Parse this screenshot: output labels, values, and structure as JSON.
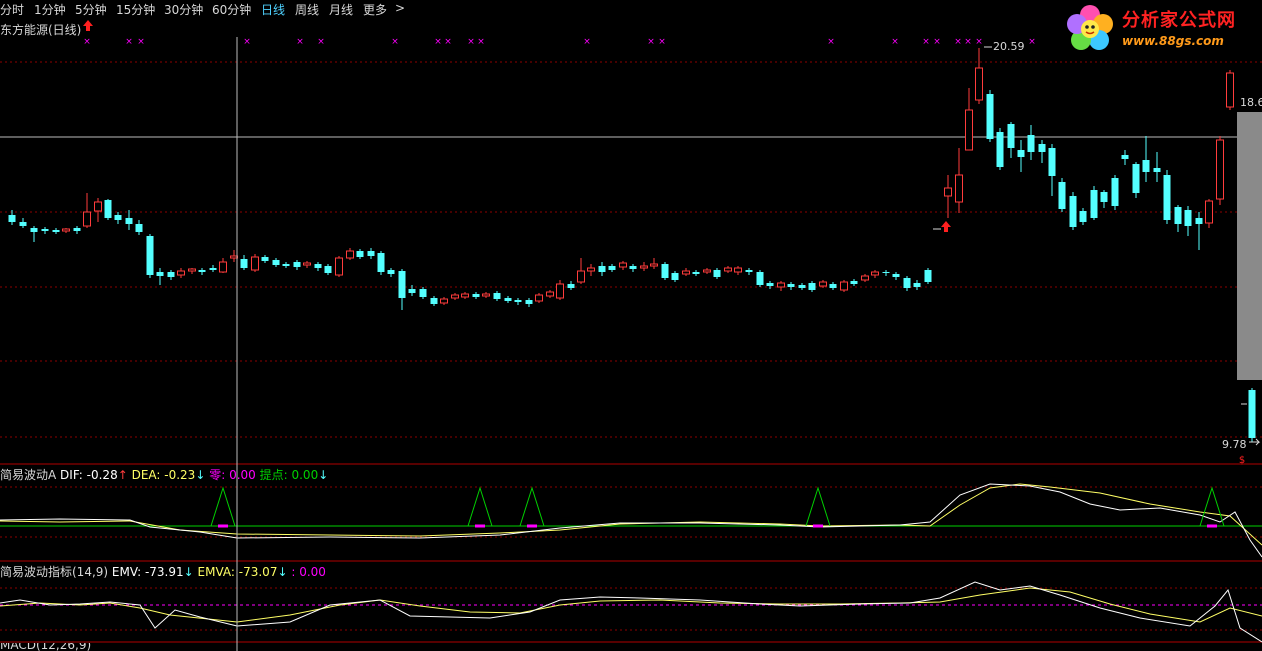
{
  "toolbar": {
    "items": [
      "分时",
      "1分钟",
      "5分钟",
      "15分钟",
      "30分钟",
      "60分钟",
      "日线",
      "周线",
      "月线",
      "更多"
    ],
    "active": "日线",
    "more_arrow": ">"
  },
  "stock_title": "东方能源(日线)",
  "logo": {
    "title": "分析家公式网",
    "url": "www.88gs.com"
  },
  "price_labels": {
    "high": "20.59",
    "right_top": "18.6",
    "low": "9.78"
  },
  "indicators": {
    "panel1": {
      "name": "简易波动A",
      "dif_label": "DIF: -0.28",
      "dea_label": "DEA: -0.23",
      "zero_label": "零: 0.00",
      "tip_label": "提点: 0.00"
    },
    "panel2": {
      "name": "简易波动指标(14,9)",
      "emv_label": "EMV: -73.91",
      "emva_label": "EMVA: -73.07",
      "extra_label": ": 0.00"
    },
    "panel3": {
      "name": "MACD(12,26,9)"
    }
  },
  "colors": {
    "up": "#ff3c3c",
    "down": "#54ffff",
    "grid": "#8b0000",
    "dif_line": "#ffffff",
    "dea_line": "#ffff66",
    "zero_line": "#00d000",
    "signal_mark": "#ff00ff",
    "green_peak": "#00d000"
  }
}
